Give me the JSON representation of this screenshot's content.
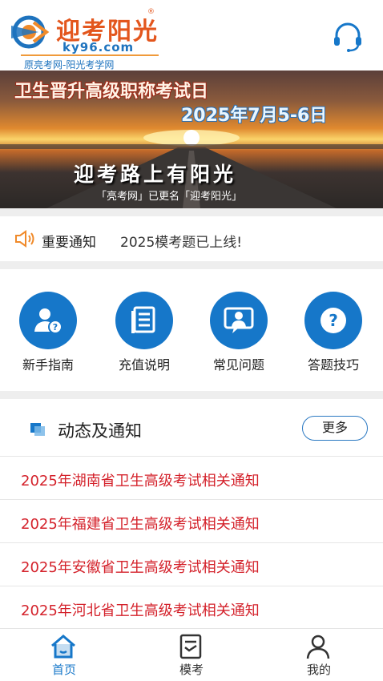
{
  "header": {
    "logo_name": "迎考阳光",
    "logo_reg": "®",
    "logo_url": "ky96.com",
    "logo_subtitle": "原亮考网-阳光考学网",
    "support_icon": "headset-icon"
  },
  "banner": {
    "title": "卫生晋升高级职称考试日",
    "date": "2025年7月5-6日",
    "slogan": "迎考路上有阳光",
    "note": "「亮考网」已更名「迎考阳光」"
  },
  "notice": {
    "icon": "speaker-icon",
    "label": "重要通知",
    "text": "2025模考题已上线!"
  },
  "quick_menu": [
    {
      "label": "新手指南",
      "icon": "user-help-icon"
    },
    {
      "label": "充值说明",
      "icon": "document-icon"
    },
    {
      "label": "常见问题",
      "icon": "faq-chat-icon"
    },
    {
      "label": "答题技巧",
      "icon": "question-icon"
    }
  ],
  "news": {
    "title": "动态及通知",
    "more_label": "更多",
    "items": [
      "2025年湖南省卫生高级考试相关通知",
      "2025年福建省卫生高级考试相关通知",
      "2025年安徽省卫生高级考试相关通知",
      "2025年河北省卫生高级考试相关通知"
    ]
  },
  "tabbar": {
    "tabs": [
      {
        "label": "首页",
        "icon": "home-icon",
        "active": true
      },
      {
        "label": "模考",
        "icon": "exam-icon",
        "active": false
      },
      {
        "label": "我的",
        "icon": "profile-icon",
        "active": false
      }
    ]
  },
  "colors": {
    "brand_blue": "#1677c9",
    "brand_orange": "#e3561d",
    "news_red": "#d4222b",
    "tab_active": "#1677c9",
    "tab_inactive": "#333333"
  }
}
